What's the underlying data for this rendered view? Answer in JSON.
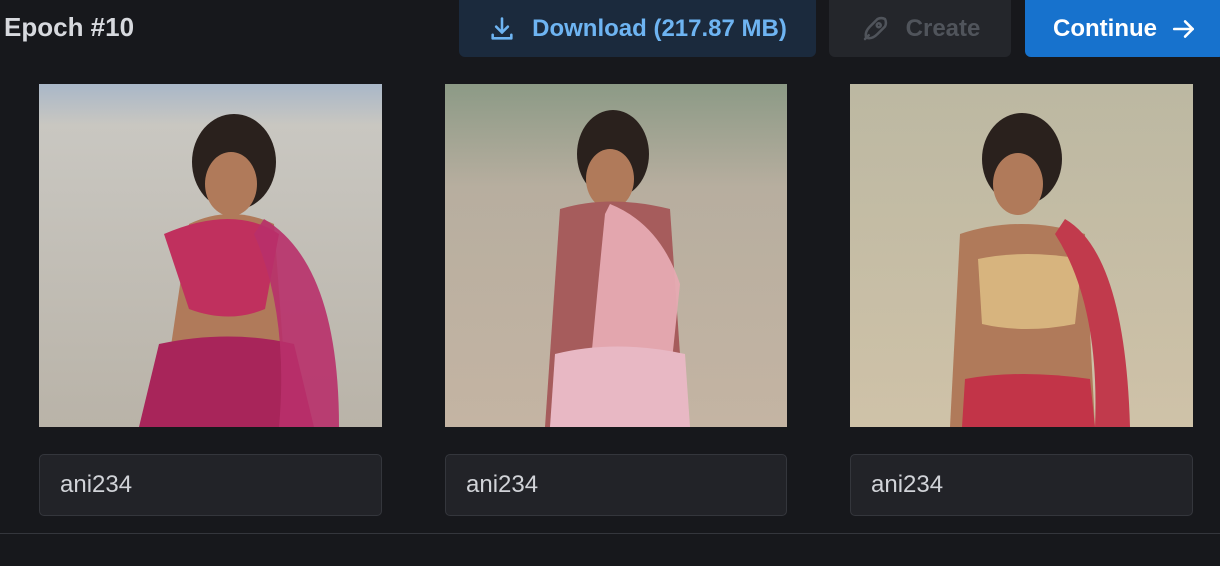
{
  "header": {
    "epoch_title": "Epoch #10"
  },
  "toolbar": {
    "download_label": "Download (217.87 MB)",
    "create_label": "Create",
    "continue_label": "Continue"
  },
  "samples": [
    {
      "prompt_value": "ani234"
    },
    {
      "prompt_value": "ani234"
    },
    {
      "prompt_value": "ani234"
    }
  ],
  "colors": {
    "background": "#17181c",
    "accent": "#1772cd",
    "download_text": "#6eb4f2"
  },
  "icons": {
    "download": "download-icon",
    "create": "rocket-icon",
    "continue": "arrow-right-icon"
  }
}
